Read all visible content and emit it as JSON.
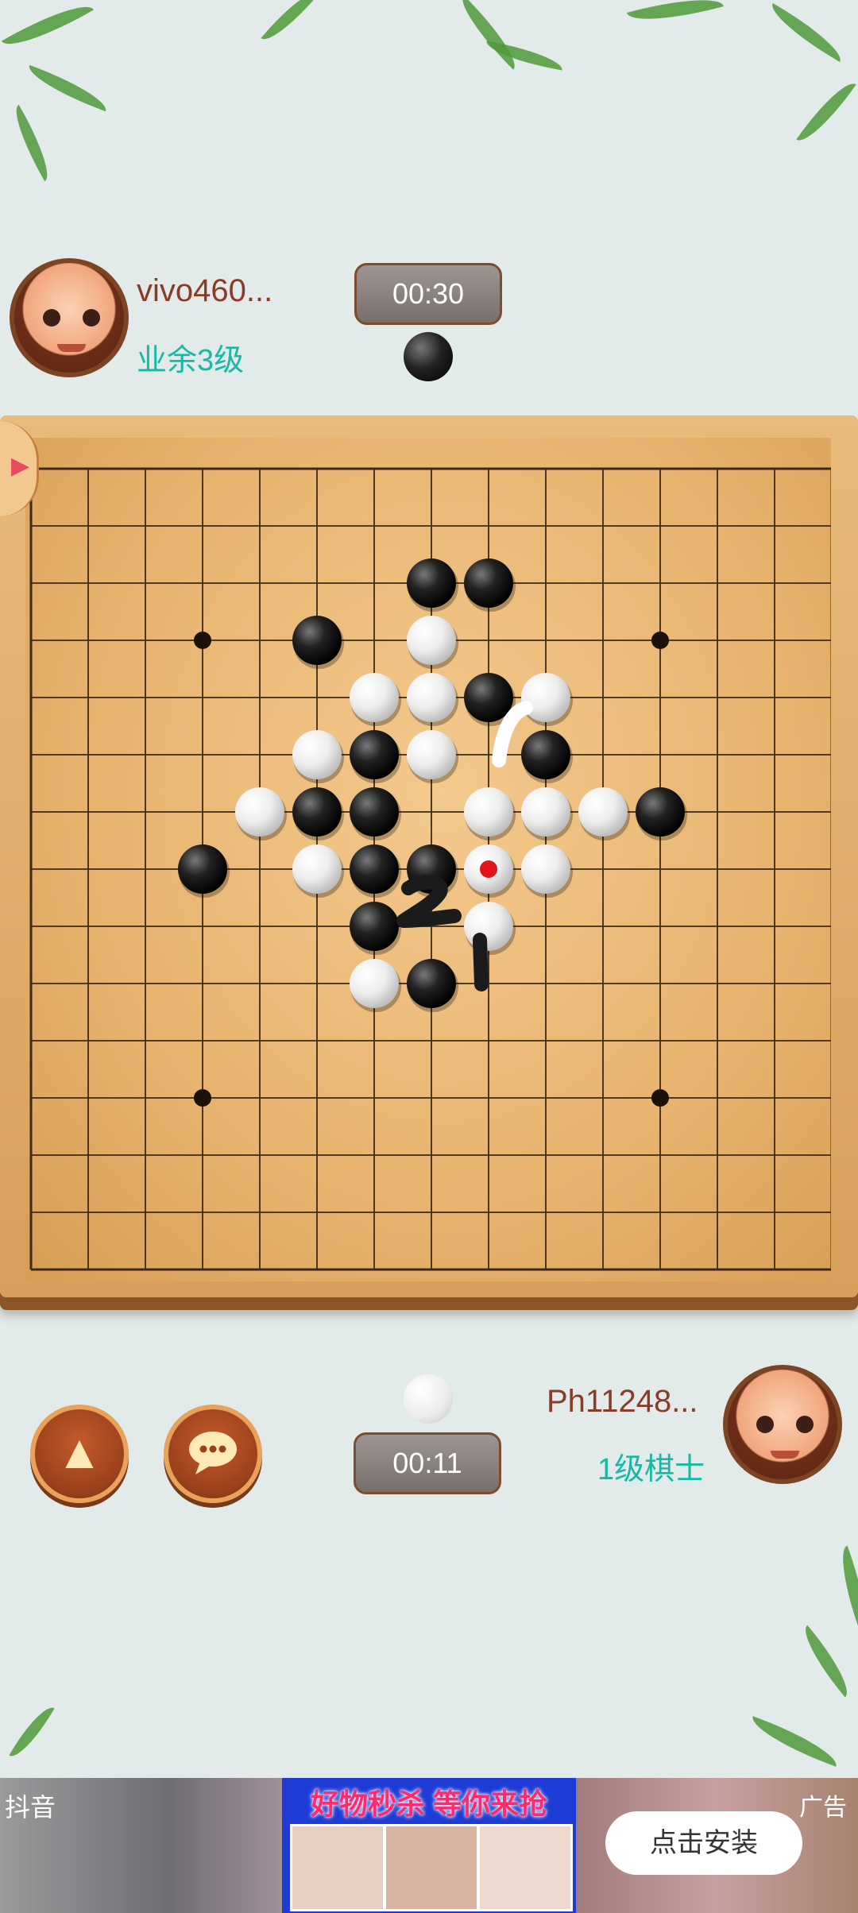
{
  "opponent": {
    "name": "vivo460...",
    "rank": "业余3级",
    "timer": "00:30",
    "stone_color": "black"
  },
  "player": {
    "name": "Ph11248...",
    "rank": "1级棋士",
    "timer": "00:11",
    "stone_color": "white"
  },
  "board": {
    "size": 15,
    "star_points": [
      [
        3,
        3
      ],
      [
        11,
        3
      ],
      [
        3,
        11
      ],
      [
        11,
        11
      ]
    ],
    "black_stones": [
      [
        7,
        2
      ],
      [
        8,
        2
      ],
      [
        5,
        3
      ],
      [
        8,
        4
      ],
      [
        6,
        5
      ],
      [
        9,
        5
      ],
      [
        5,
        6
      ],
      [
        6,
        6
      ],
      [
        11,
        6
      ],
      [
        3,
        7
      ],
      [
        6,
        7
      ],
      [
        7,
        7
      ],
      [
        6,
        8
      ],
      [
        7,
        9
      ]
    ],
    "white_stones": [
      [
        7,
        3
      ],
      [
        6,
        4
      ],
      [
        7,
        4
      ],
      [
        9,
        4
      ],
      [
        5,
        5
      ],
      [
        7,
        5
      ],
      [
        4,
        6
      ],
      [
        8,
        6
      ],
      [
        9,
        6
      ],
      [
        10,
        6
      ],
      [
        5,
        7
      ],
      [
        8,
        7
      ],
      [
        9,
        7
      ],
      [
        8,
        8
      ],
      [
        6,
        9
      ]
    ],
    "last_move": [
      8,
      7
    ],
    "last_move_color": "#e0151b"
  },
  "controls": {
    "undo_icon": "undo-arrow-icon",
    "chat_icon": "chat-bubble-icon"
  },
  "ad": {
    "brand": "抖音",
    "banner_text": "好物秒杀 等你来抢",
    "label": "广告",
    "install_label": "点击安装"
  }
}
